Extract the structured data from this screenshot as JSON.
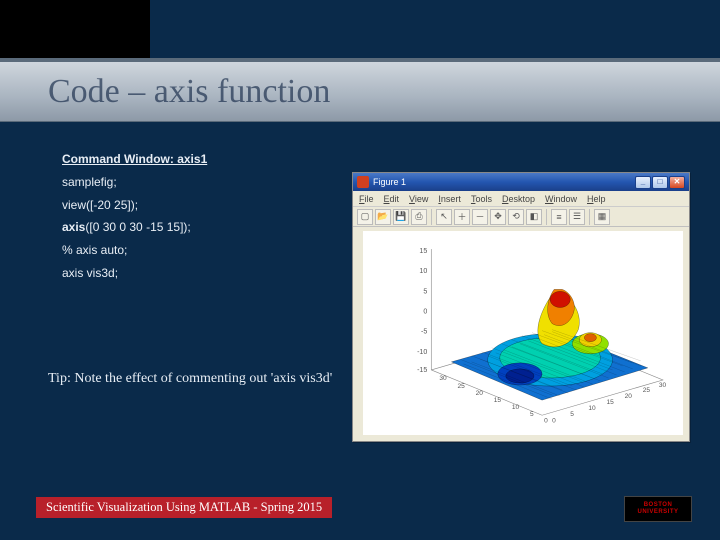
{
  "slide": {
    "title": "Code – axis function",
    "command_window_heading": "Command Window: axis1",
    "code_lines": [
      "samplefig;",
      "view([-20 25]);",
      "axis([0 30 0 30 -15 15]);",
      "% axis auto;",
      "axis vis3d;"
    ],
    "bold_token": "axis",
    "tip": "Tip: Note the effect of commenting out 'axis vis3d'",
    "footer": "Scientific Visualization Using MATLAB - Spring 2015",
    "logo": {
      "line1": "BOSTON",
      "line2": "UNIVERSITY"
    }
  },
  "figure_window": {
    "title": "Figure 1",
    "menus": [
      "File",
      "Edit",
      "View",
      "Insert",
      "Tools",
      "Desktop",
      "Window",
      "Help"
    ],
    "window_buttons": {
      "min": "_",
      "max": "□",
      "close": "✕"
    },
    "z_ticks": [
      "15",
      "10",
      "5",
      "0",
      "-5",
      "-10",
      "-15"
    ],
    "xy_ticks": [
      "0",
      "5",
      "10",
      "15",
      "20",
      "25",
      "30"
    ]
  },
  "chart_data": {
    "type": "area",
    "title": "",
    "xlabel": "",
    "ylabel": "",
    "zlabel": "",
    "x_range": [
      0,
      30
    ],
    "y_range": [
      0,
      30
    ],
    "z_range": [
      -15,
      15
    ],
    "view": [
      -20,
      25
    ],
    "description": "3D surface plot (MATLAB peaks-like) shown in a Figure 1 window with jet colormap; axis limits [0 30 0 30 -15 15]."
  },
  "colors": {
    "slide_bg": "#0a2a4a",
    "accent_red": "#b8202a",
    "titlebar_blue": "#2456b0"
  }
}
